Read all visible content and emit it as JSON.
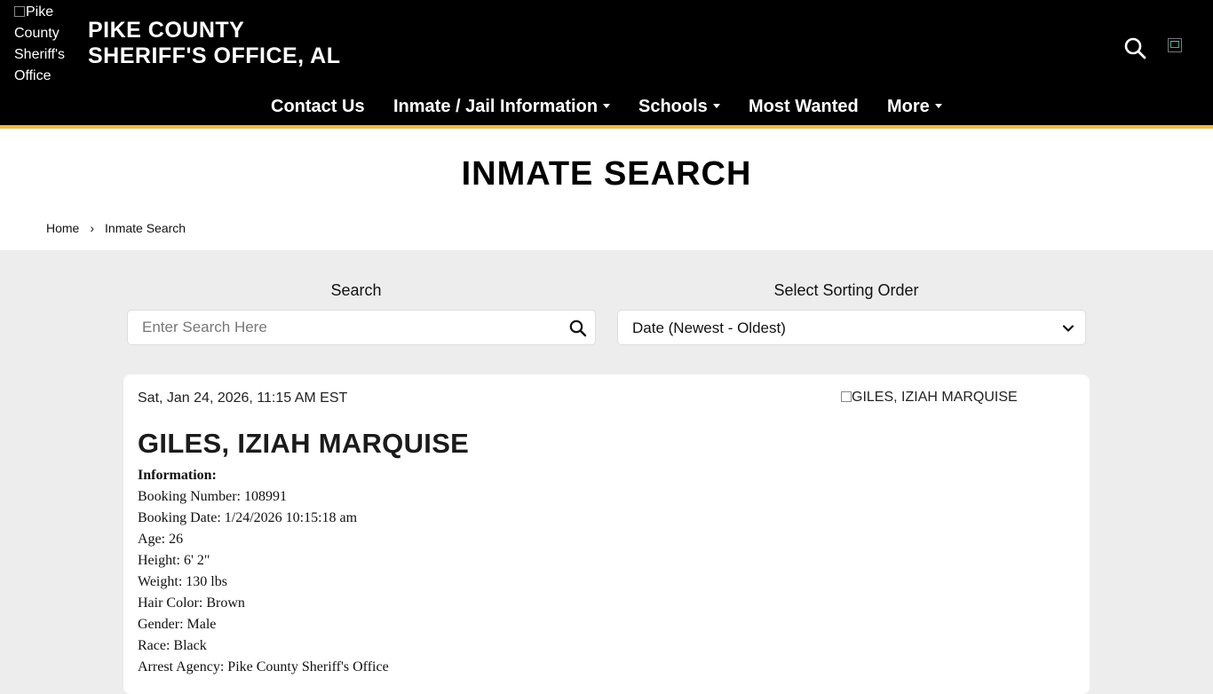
{
  "header": {
    "logo_alt": "Pike County Sheriff's Office",
    "site_title_line1": "PIKE COUNTY",
    "site_title_line2": "SHERIFF'S OFFICE, AL",
    "colors": {
      "background": "#000000",
      "accent_stripe": "#f0b94a"
    }
  },
  "nav": {
    "items": [
      {
        "label": "Contact Us",
        "has_dropdown": false
      },
      {
        "label": "Inmate / Jail Information",
        "has_dropdown": true
      },
      {
        "label": "Schools",
        "has_dropdown": true
      },
      {
        "label": "Most Wanted",
        "has_dropdown": false
      },
      {
        "label": "More",
        "has_dropdown": true
      }
    ]
  },
  "page": {
    "title": "INMATE SEARCH",
    "breadcrumb": {
      "home": "Home",
      "separator": "›",
      "current": "Inmate Search"
    }
  },
  "search": {
    "label": "Search",
    "placeholder": "Enter Search Here",
    "value": "",
    "icon": "search-icon"
  },
  "sort": {
    "label": "Select Sorting Order",
    "selected": "Date (Newest - Oldest)",
    "icon": "chevron-down-icon"
  },
  "inmate": {
    "date": "Sat, Jan 24, 2026, 11:15 AM EST",
    "photo_alt": "GILES, IZIAH MARQUISE",
    "name": "GILES, IZIAH MARQUISE",
    "info_heading": "Information:",
    "fields": [
      "Booking Number: 108991",
      "Booking Date: 1/24/2026 10:15:18 am",
      "Age: 26",
      "Height: 6' 2\"",
      "Weight: 130 lbs",
      "Hair Color: Brown",
      "Gender: Male",
      "Race: Black",
      "Arrest Agency: Pike County Sheriff's Office"
    ]
  }
}
